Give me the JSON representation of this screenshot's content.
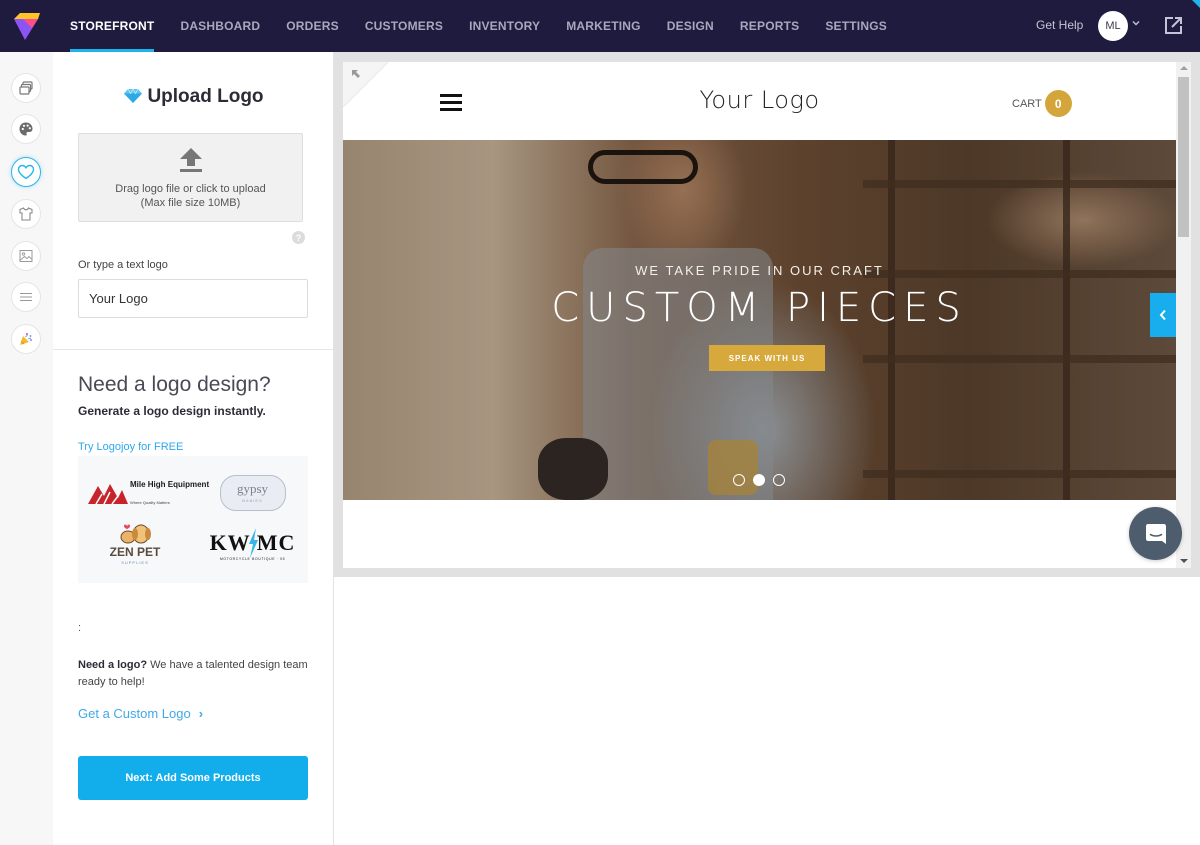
{
  "topnav": {
    "brand_icon": "app-logo",
    "items": [
      {
        "label": "STOREFRONT",
        "active": true
      },
      {
        "label": "DASHBOARD",
        "active": false
      },
      {
        "label": "ORDERS",
        "active": false
      },
      {
        "label": "CUSTOMERS",
        "active": false
      },
      {
        "label": "INVENTORY",
        "active": false
      },
      {
        "label": "MARKETING",
        "active": false
      },
      {
        "label": "DESIGN",
        "active": false
      },
      {
        "label": "REPORTS",
        "active": false
      },
      {
        "label": "SETTINGS",
        "active": false
      }
    ],
    "help_label": "Get Help",
    "avatar_initials": "ML",
    "accent_color": "#1fb3ee"
  },
  "rail": {
    "items": [
      {
        "icon": "layers-icon",
        "active": false
      },
      {
        "icon": "palette-icon",
        "active": false
      },
      {
        "icon": "heart-icon",
        "active": true
      },
      {
        "icon": "tshirt-icon",
        "active": false
      },
      {
        "icon": "image-icon",
        "active": false
      },
      {
        "icon": "menu-lines-icon",
        "active": false
      },
      {
        "icon": "party-popper-icon",
        "active": false
      }
    ]
  },
  "panel": {
    "title": "Upload Logo",
    "upload": {
      "line1": "Drag logo file or click to upload",
      "line2": "(Max file size 10MB)"
    },
    "help_glyph": "?",
    "text_logo_label": "Or type a text logo",
    "text_logo_value": "Your Logo",
    "promo": {
      "heading": "Need a logo design?",
      "subheading": "Generate a logo design instantly.",
      "link": "Try Logojoy for FREE",
      "samples": [
        {
          "name": "Mile High Equipment",
          "tagline": "Where Quality Matters"
        },
        {
          "name": "gypsy",
          "tagline": "BABIES"
        },
        {
          "name": "ZEN PET",
          "tagline": "SUPPLIES"
        },
        {
          "name": "KW MC",
          "tagline": "MOTORCYCLE BOUTIQUE · 05"
        }
      ]
    },
    "colon": ":",
    "custom": {
      "bold": "Need a logo?",
      "text": " We have a talented design team ready to help!",
      "link": "Get a Custom Logo",
      "link_chevron": "›"
    },
    "next_button": "Next: Add Some Products"
  },
  "preview": {
    "site_logo": "Your Logo",
    "cart_label": "CART",
    "cart_count": "0",
    "hero": {
      "subtitle": "WE TAKE PRIDE IN OUR CRAFT",
      "title": "CUSTOM PIECES",
      "button": "SPEAK WITH US",
      "slide_count": 3,
      "active_slide": 2,
      "accent_color": "#d7a93c"
    },
    "side_toggle_glyph": "‹"
  }
}
